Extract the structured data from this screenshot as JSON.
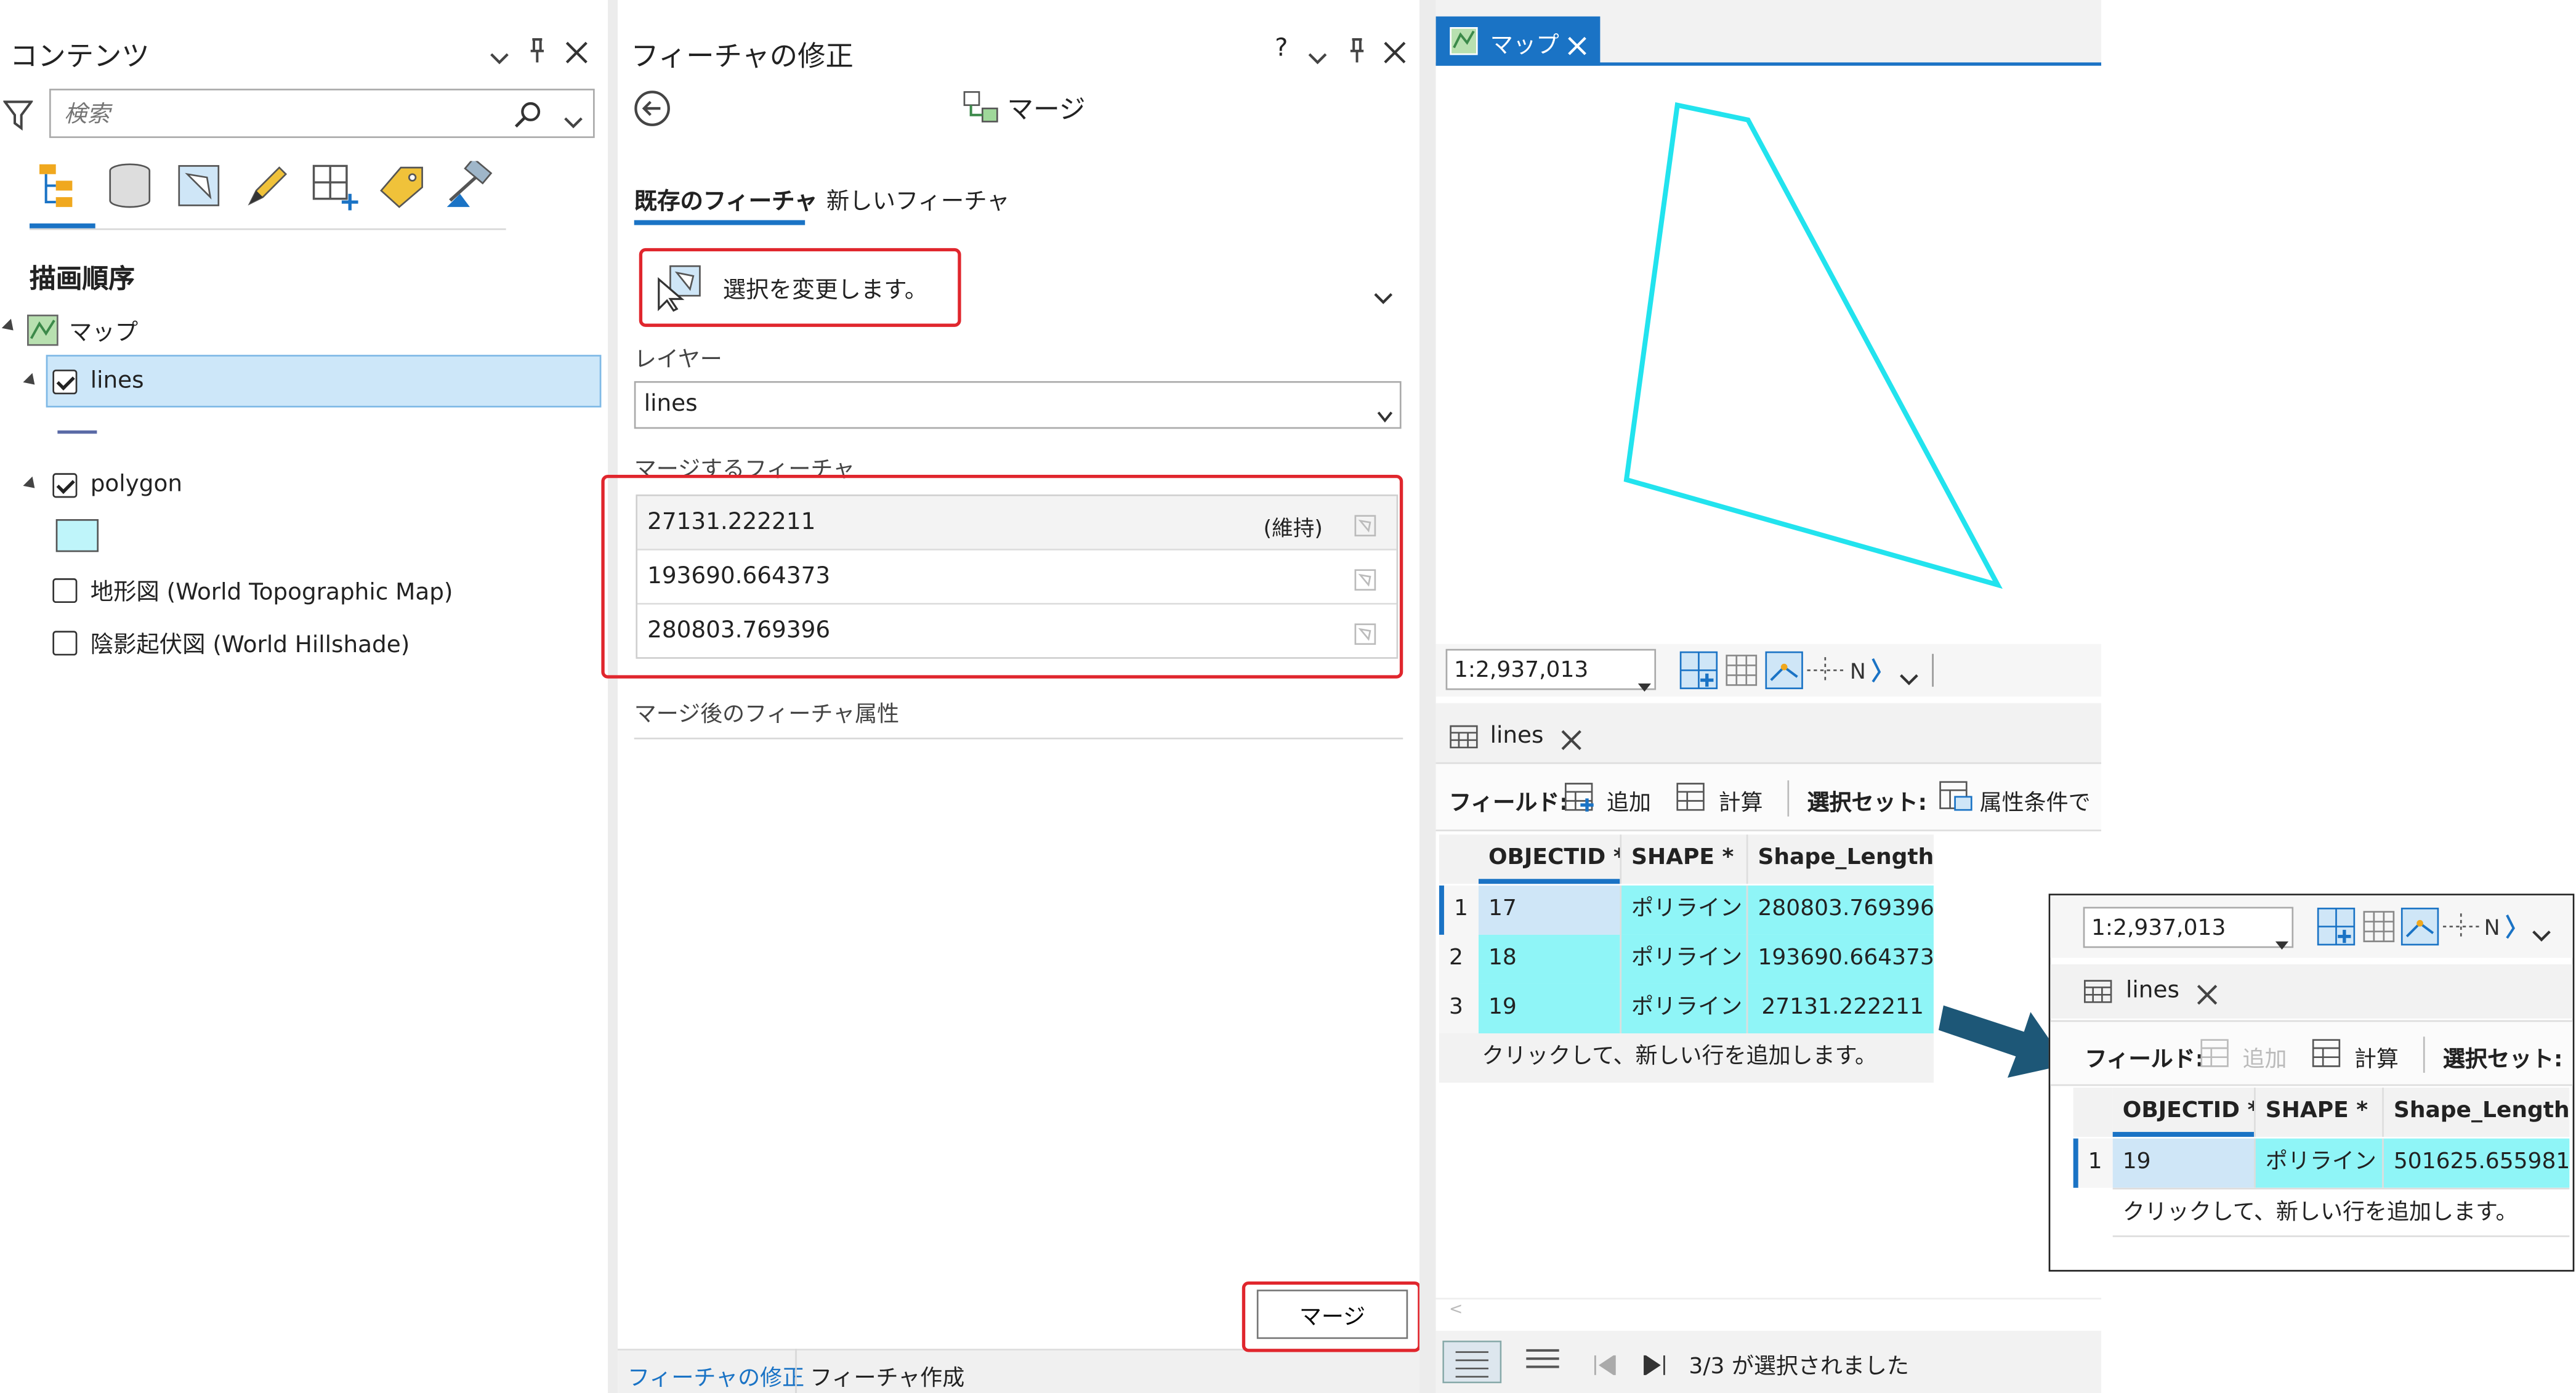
{
  "contents": {
    "title": "コンテンツ",
    "search_placeholder": "検索",
    "draw_order": "描画順序",
    "map_item": "マップ",
    "layers": [
      {
        "label": "lines",
        "checked": true,
        "selected": true
      },
      {
        "label": "polygon",
        "checked": true,
        "selected": false
      },
      {
        "label": "地形図 (World Topographic Map)",
        "checked": false
      },
      {
        "label": "陰影起伏図 (World Hillshade)",
        "checked": false
      }
    ]
  },
  "modify": {
    "title": "フィーチャの修正",
    "help": "?",
    "tool_name": "マージ",
    "tab_existing": "既存のフィーチャ",
    "tab_new": "新しいフィーチャ",
    "change_selection": "選択を変更します。",
    "layer_label": "レイヤー",
    "layer_value": "lines",
    "features_label": "マージするフィーチャ",
    "features": [
      {
        "value": "27131.222211",
        "tag": "(維持)"
      },
      {
        "value": "193690.664373",
        "tag": ""
      },
      {
        "value": "280803.769396",
        "tag": ""
      }
    ],
    "attrs_label": "マージ後のフィーチャ属性",
    "merge_button": "マージ",
    "bottom_tabs": [
      "フィーチャの修正",
      "フィーチャ作成"
    ]
  },
  "map": {
    "tab_label": "マップ",
    "scale": "1:2,937,013",
    "outline_color": "#22e3ee"
  },
  "table": {
    "tab_label": "lines",
    "toolbar": {
      "field": "フィールド:",
      "add": "追加",
      "calc": "計算",
      "selset": "選択セット:",
      "attr_cond": "属性条件で"
    },
    "columns": [
      "OBJECTID *",
      "SHAPE *",
      "Shape_Length"
    ],
    "rows": [
      {
        "n": "1",
        "id": "17",
        "shape": "ポリライン Z",
        "len": "280803.769396"
      },
      {
        "n": "2",
        "id": "18",
        "shape": "ポリライン Z",
        "len": "193690.664373"
      },
      {
        "n": "3",
        "id": "19",
        "shape": "ポリライン Z",
        "len": "27131.222211"
      }
    ],
    "add_row": "クリックして、新しい行を追加します。",
    "status": "3/3 が選択されました"
  },
  "result": {
    "scale": "1:2,937,013",
    "tab_label": "lines",
    "toolbar": {
      "field": "フィールド:",
      "add": "追加",
      "calc": "計算",
      "selset": "選択セット:"
    },
    "columns": [
      "OBJECTID *",
      "SHAPE *",
      "Shape_Length"
    ],
    "rows": [
      {
        "n": "1",
        "id": "19",
        "shape": "ポリライン Z",
        "len": "501625.655981"
      }
    ],
    "add_row": "クリックして、新しい行を追加します。"
  },
  "colors": {
    "accent": "#1a73c5",
    "selection": "#8ff5f7",
    "highlight_red": "#e0262d",
    "arrow": "#1d5777"
  }
}
